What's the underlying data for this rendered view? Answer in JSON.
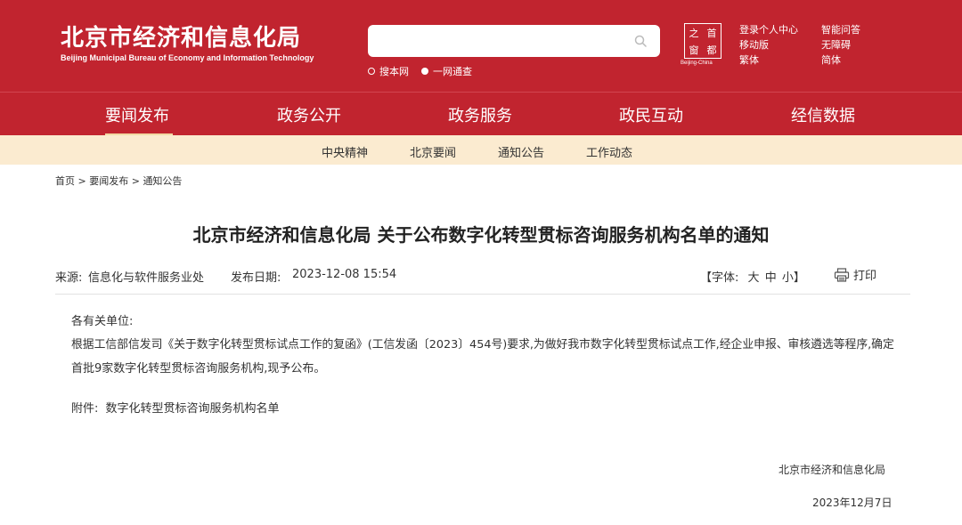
{
  "header": {
    "title": "北京市经济和信息化局",
    "subtitle": "Beijing Municipal Bureau of Economy and Information Technology",
    "search": {
      "placeholder": "",
      "value": ""
    },
    "scopes": [
      {
        "label": "搜本网",
        "selected": false
      },
      {
        "label": "一网通查",
        "selected": true
      }
    ],
    "seal": {
      "chars": [
        "之",
        "首",
        "窗",
        "都"
      ],
      "caption": "Beijing-China"
    },
    "tools": [
      "登录个人中心",
      "智能问答",
      "移动版",
      "无障碍",
      "繁体",
      "简体"
    ]
  },
  "nav": {
    "items": [
      "要闻发布",
      "政务公开",
      "政务服务",
      "政民互动",
      "经信数据"
    ],
    "active_index": 0
  },
  "subnav": {
    "items": [
      "中央精神",
      "北京要闻",
      "通知公告",
      "工作动态"
    ]
  },
  "breadcrumb": {
    "items": [
      "首页",
      "要闻发布",
      "通知公告"
    ],
    "separator": ">"
  },
  "article": {
    "title": "北京市经济和信息化局 关于公布数字化转型贯标咨询服务机构名单的通知",
    "source_label": "来源:",
    "source_value": "信息化与软件服务业处",
    "date_label": "发布日期:",
    "date_value": "2023-12-08 15:54",
    "font_label": "【字体:",
    "font_large": "大",
    "font_medium": "中",
    "font_small": "小】",
    "print_label": "打印",
    "greeting": "各有关单位:",
    "paragraph_line1": "根据工信部信发司《关于数字化转型贯标试点工作的复函》(工信发函〔2023〕454号)要求,为做好我市数字化转型贯标试点工作,经企业申报、审核遴选等程序,确定",
    "paragraph_line2": "首批9家数字化转型贯标咨询服务机构,现予公布。",
    "attachment_label": "附件:",
    "attachment_link": "数字化转型贯标咨询服务机构名单",
    "signature": "北京市经济和信息化局",
    "sign_date": "2023年12月7日"
  },
  "colors": {
    "brand_red": "#c1242f",
    "subnav_bg": "#fbebd0",
    "active_underline": "#f2d9a4"
  }
}
